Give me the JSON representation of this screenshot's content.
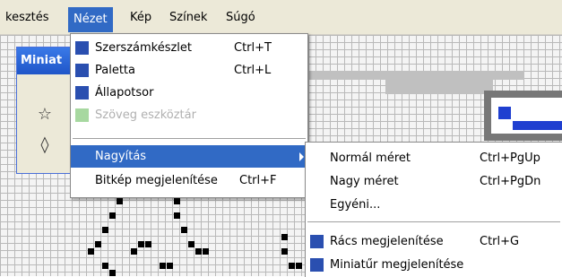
{
  "menubar": {
    "items": [
      {
        "label": "kesztés"
      },
      {
        "label": "Nézet"
      },
      {
        "label": "Kép"
      },
      {
        "label": "Színek"
      },
      {
        "label": "Súgó"
      }
    ]
  },
  "mini_window": {
    "title": "Miniat",
    "tools": [
      {
        "icon": "star-select-icon"
      },
      {
        "icon": "eraser-icon"
      }
    ]
  },
  "view_menu": {
    "items": [
      {
        "label": "Szerszámkészlet",
        "shortcut": "Ctrl+T",
        "checked": true
      },
      {
        "label": "Paletta",
        "shortcut": "Ctrl+L",
        "checked": true
      },
      {
        "label": "Állapotsor",
        "shortcut": "",
        "checked": true
      },
      {
        "label": "Szöveg eszköztár",
        "shortcut": "",
        "checked": true,
        "disabled": true
      },
      {
        "label": "Nagyítás",
        "shortcut": "",
        "has_submenu": true,
        "highlighted": true
      },
      {
        "label": "Bitkép megjelenítése",
        "shortcut": "Ctrl+F"
      }
    ]
  },
  "zoom_submenu": {
    "items": [
      {
        "label": "Normál méret",
        "shortcut": "Ctrl+PgUp"
      },
      {
        "label": "Nagy méret",
        "shortcut": "Ctrl+PgDn"
      },
      {
        "label": "Egyéni...",
        "shortcut": ""
      },
      {
        "label": "Rács megjelenítése",
        "shortcut": "Ctrl+G",
        "checked": true
      },
      {
        "label": "Miniatűr megjelenítése",
        "shortcut": "",
        "checked": true
      }
    ]
  },
  "colors": {
    "menu_highlight": "#316ac5",
    "check_box": "#2a4fb0",
    "menubar_bg": "#ece9d8"
  }
}
